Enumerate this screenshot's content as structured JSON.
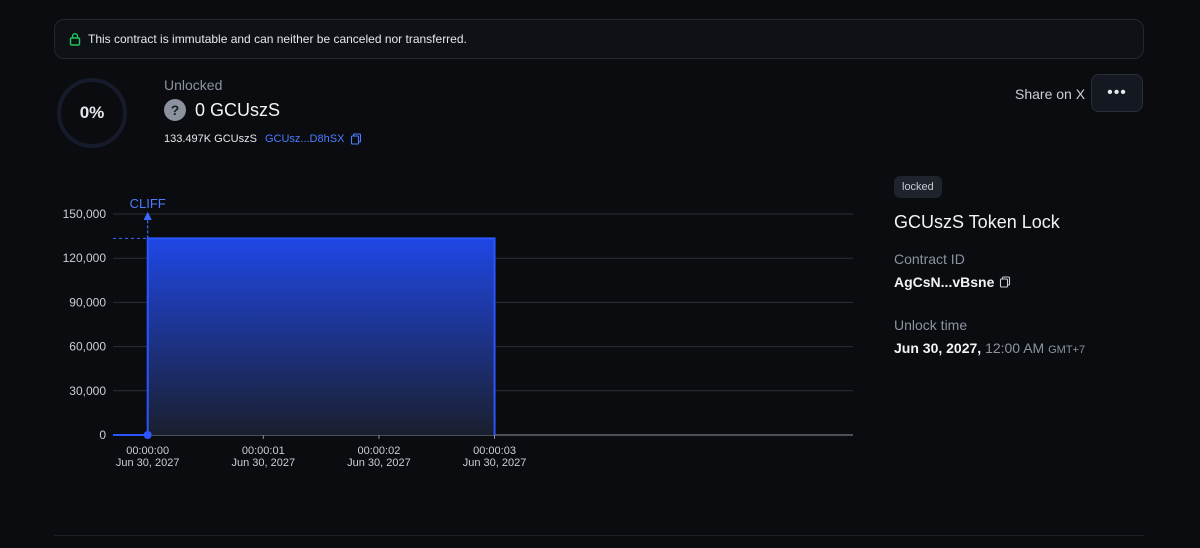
{
  "banner": {
    "text": "This contract is immutable and can neither be canceled nor transferred."
  },
  "progress": {
    "percent_label": "0%",
    "fraction": 0
  },
  "unlocked": {
    "label": "Unlocked",
    "amount": "0 GCUszS",
    "total": "133.497K GCUszS",
    "address": "GCUsz...D8hSX"
  },
  "actions": {
    "share_label": "Share on X",
    "more_label": "•••"
  },
  "sidebar": {
    "status_badge": "locked",
    "title": "GCUszS Token Lock",
    "contract_id_label": "Contract ID",
    "contract_id": "AgCsN...vBsne",
    "unlock_time_label": "Unlock time",
    "unlock_date": "Jun 30, 2027,",
    "unlock_time": "12:00 AM",
    "unlock_tz": "GMT+7"
  },
  "colors": {
    "accent": "#2b55ff",
    "background": "#0a0c10",
    "muted": "#8b93a1",
    "success": "#22c55e"
  },
  "chart_data": {
    "type": "area",
    "annotation": "CLIFF",
    "ylim": [
      0,
      150000
    ],
    "y_ticks": [
      "150,000",
      "120,000",
      "90,000",
      "60,000",
      "30,000",
      "0"
    ],
    "y_tick_values": [
      150000,
      120000,
      90000,
      60000,
      30000,
      0
    ],
    "x_ticks": [
      {
        "time": "00:00:00",
        "date": "Jun 30, 2027"
      },
      {
        "time": "00:00:01",
        "date": "Jun 30, 2027"
      },
      {
        "time": "00:00:02",
        "date": "Jun 30, 2027"
      },
      {
        "time": "00:00:03",
        "date": "Jun 30, 2027"
      }
    ],
    "x_tick_values": [
      0,
      1,
      2,
      3
    ],
    "xlim": [
      -0.3,
      6.1
    ],
    "series": [
      {
        "x": [
          -0.3,
          0,
          0,
          3
        ],
        "y": [
          0,
          0,
          133497,
          133497
        ]
      }
    ],
    "total_value": 133497
  }
}
